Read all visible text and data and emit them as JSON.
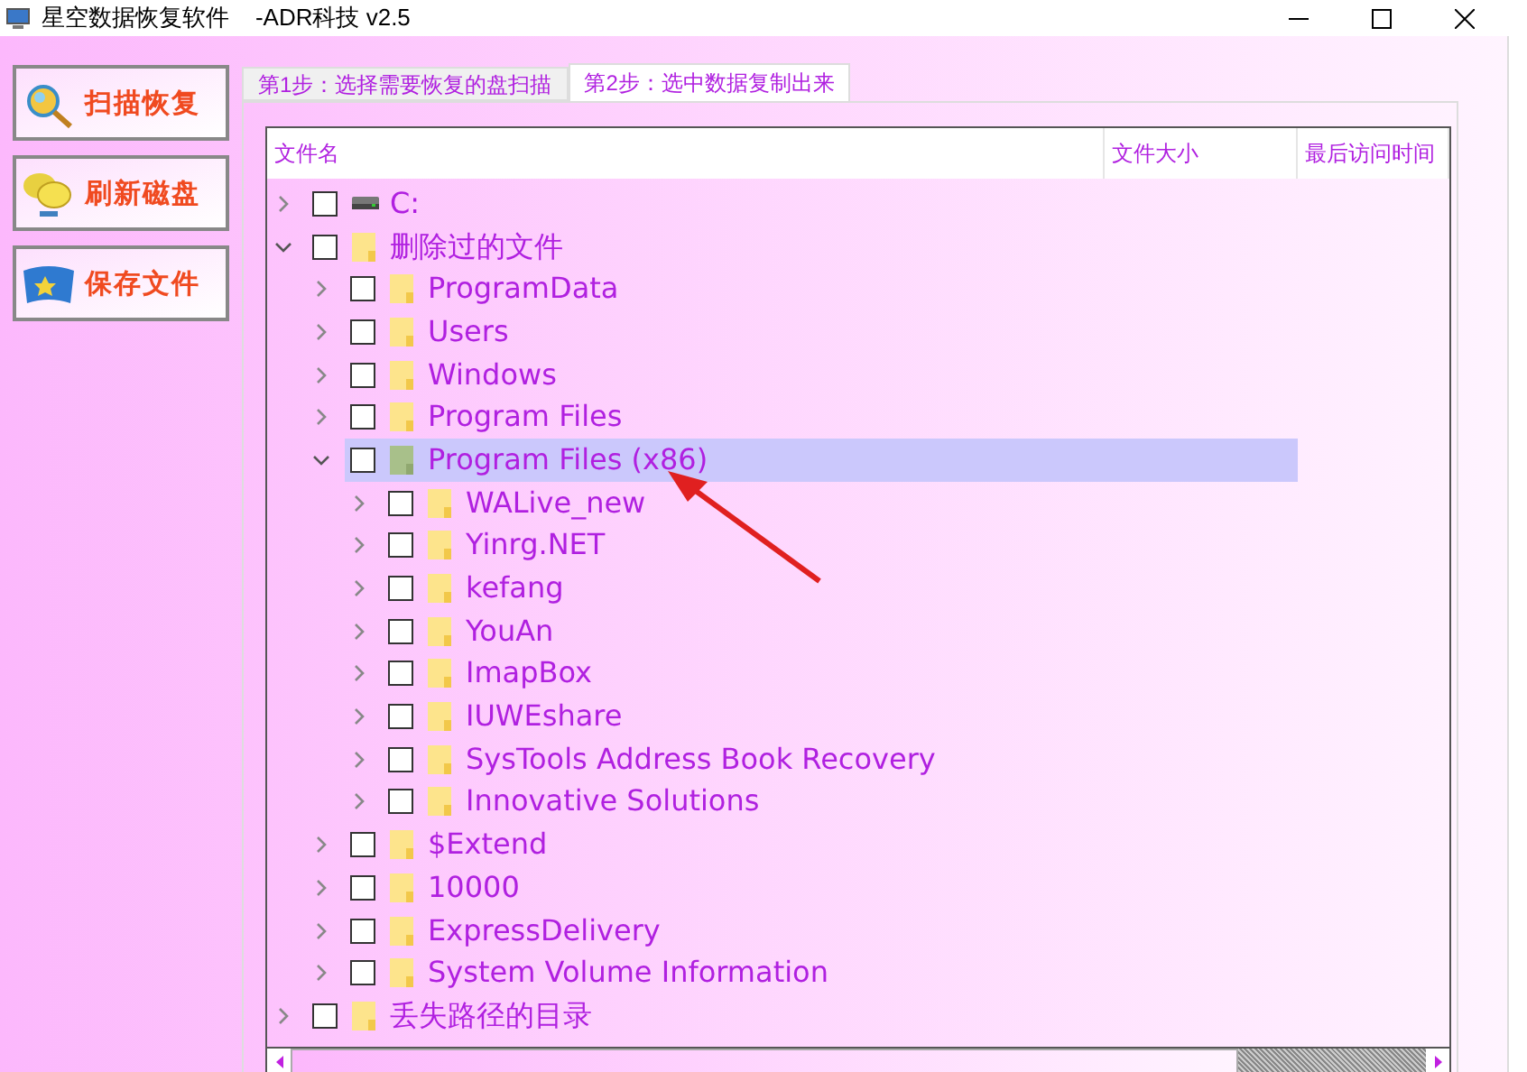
{
  "window": {
    "title": "星空数据恢复软件    -ADR科技 v2.5"
  },
  "side_buttons": [
    {
      "label": "扫描恢复",
      "kind": "scan"
    },
    {
      "label": "刷新磁盘",
      "kind": "refresh"
    },
    {
      "label": "保存文件",
      "kind": "save"
    }
  ],
  "tabs": [
    {
      "label": "第1步：选择需要恢复的盘扫描",
      "selected": false
    },
    {
      "label": "第2步：选中数据复制出来",
      "selected": true
    }
  ],
  "tree": {
    "columns": [
      "文件名",
      "文件大小",
      "最后访问时间"
    ],
    "items": [
      {
        "name": "C:",
        "kind": "drive",
        "expanded": false,
        "checked": false,
        "selected": false
      },
      {
        "name": "删除过的文件",
        "kind": "folder",
        "expanded": true,
        "checked": false,
        "selected": false,
        "children": [
          {
            "name": "ProgramData",
            "kind": "folder",
            "expanded": false,
            "checked": false,
            "selected": false
          },
          {
            "name": "Users",
            "kind": "folder",
            "expanded": false,
            "checked": false,
            "selected": false
          },
          {
            "name": "Windows",
            "kind": "folder",
            "expanded": false,
            "checked": false,
            "selected": false
          },
          {
            "name": "Program Files",
            "kind": "folder",
            "expanded": false,
            "checked": false,
            "selected": false
          },
          {
            "name": "Program Files (x86)",
            "kind": "folder",
            "expanded": true,
            "checked": false,
            "selected": true,
            "children": [
              {
                "name": "WALive_new",
                "kind": "folder",
                "expanded": false,
                "checked": false,
                "selected": false
              },
              {
                "name": "Yinrg.NET",
                "kind": "folder",
                "expanded": false,
                "checked": false,
                "selected": false
              },
              {
                "name": "kefang",
                "kind": "folder",
                "expanded": false,
                "checked": false,
                "selected": false
              },
              {
                "name": "YouAn",
                "kind": "folder",
                "expanded": false,
                "checked": false,
                "selected": false
              },
              {
                "name": "ImapBox",
                "kind": "folder",
                "expanded": false,
                "checked": false,
                "selected": false
              },
              {
                "name": "IUWEshare",
                "kind": "folder",
                "expanded": false,
                "checked": false,
                "selected": false
              },
              {
                "name": "SysTools Address Book Recovery",
                "kind": "folder",
                "expanded": false,
                "checked": false,
                "selected": false
              },
              {
                "name": "Innovative Solutions",
                "kind": "folder",
                "expanded": false,
                "checked": false,
                "selected": false
              }
            ]
          },
          {
            "name": "$Extend",
            "kind": "folder",
            "expanded": false,
            "checked": false,
            "selected": false
          },
          {
            "name": "10000",
            "kind": "folder",
            "expanded": false,
            "checked": false,
            "selected": false
          },
          {
            "name": "ExpressDelivery",
            "kind": "folder",
            "expanded": false,
            "checked": false,
            "selected": false
          },
          {
            "name": "System Volume Information",
            "kind": "folder",
            "expanded": false,
            "checked": false,
            "selected": false
          }
        ]
      },
      {
        "name": "丢失路径的目录",
        "kind": "folder",
        "expanded": false,
        "checked": false,
        "selected": false
      }
    ]
  }
}
